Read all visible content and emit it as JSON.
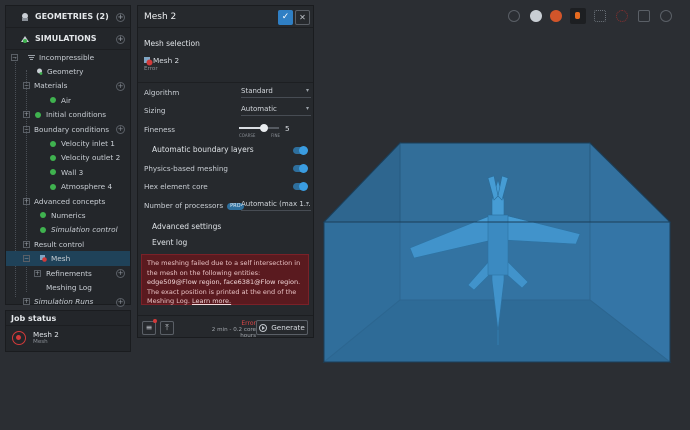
{
  "tree": {
    "geometries_label": "GEOMETRIES (2)",
    "simulations_label": "SIMULATIONS",
    "items": [
      {
        "label": "Incompressible"
      },
      {
        "label": "Geometry"
      },
      {
        "label": "Materials"
      },
      {
        "label": "Air"
      },
      {
        "label": "Initial conditions"
      },
      {
        "label": "Boundary conditions"
      },
      {
        "label": "Velocity inlet 1"
      },
      {
        "label": "Velocity outlet 2"
      },
      {
        "label": "Wall 3"
      },
      {
        "label": "Atmosphere 4"
      },
      {
        "label": "Advanced concepts"
      },
      {
        "label": "Numerics"
      },
      {
        "label": "Simulation control"
      },
      {
        "label": "Result control"
      },
      {
        "label": "Mesh"
      },
      {
        "label": "Refinements"
      },
      {
        "label": "Meshing Log"
      },
      {
        "label": "Simulation Runs"
      }
    ]
  },
  "job_status": {
    "title": "Job status",
    "job_name": "Mesh 2",
    "job_type": "Mesh"
  },
  "panel": {
    "title": "Mesh 2",
    "mesh_selection_label": "Mesh selection",
    "selection_name": "Mesh 2",
    "selection_status": "Error",
    "algorithm_label": "Algorithm",
    "algorithm_value": "Standard",
    "sizing_label": "Sizing",
    "sizing_value": "Automatic",
    "fineness_label": "Fineness",
    "fineness_value": "5",
    "fineness_fraction": 0.62,
    "coarse_label": "COARSE",
    "fine_label": "FINE",
    "auto_boundary_label": "Automatic boundary layers",
    "physics_label": "Physics-based meshing",
    "hex_label": "Hex element core",
    "processors_label": "Number of processors",
    "pro_badge": "PRO",
    "processors_value": "Automatic (max 1...",
    "advanced_label": "Advanced settings",
    "event_log_label": "Event log",
    "error_text_1": "The meshing failed due to a self intersection in the mesh on the following entities: ",
    "error_entities": "edge509@Flow region, face6381@Flow region",
    "error_text_2": ". The exact position is printed at the end of the Meshing Log. ",
    "learn_more": "Learn more.",
    "footer_status": "Error",
    "footer_time": "2 min - 0.2 core hours",
    "generate_label": "Generate"
  },
  "colors": {
    "accent": "#2f7fc4",
    "success": "#3fb24f",
    "error": "#d13a3a",
    "flow_box": "#3a86c0"
  }
}
